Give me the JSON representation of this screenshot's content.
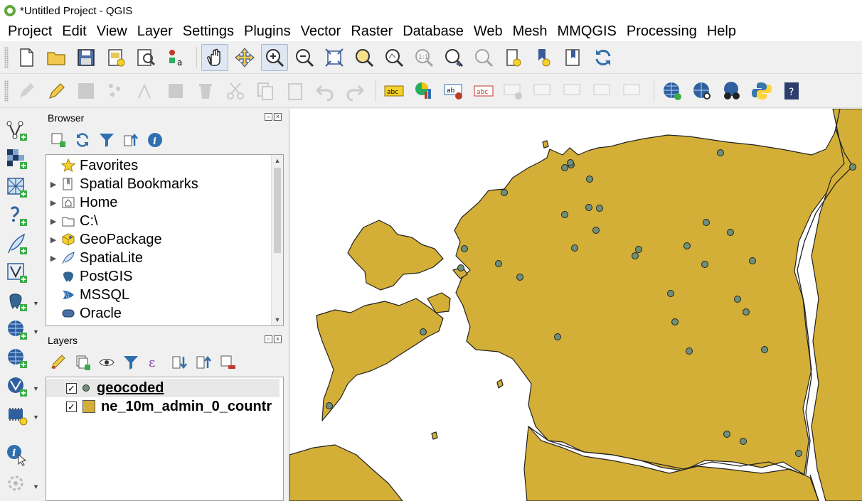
{
  "window": {
    "title": "*Untitled Project - QGIS"
  },
  "menu": [
    "Project",
    "Edit",
    "View",
    "Layer",
    "Settings",
    "Plugins",
    "Vector",
    "Raster",
    "Database",
    "Web",
    "Mesh",
    "MMQGIS",
    "Processing",
    "Help"
  ],
  "browser": {
    "title": "Browser",
    "items": [
      {
        "label": "Favorites",
        "icon": "star-icon",
        "expandable": false
      },
      {
        "label": "Spatial Bookmarks",
        "icon": "bookmark-icon",
        "expandable": true
      },
      {
        "label": "Home",
        "icon": "home-folder-icon",
        "expandable": true
      },
      {
        "label": "C:\\",
        "icon": "folder-icon",
        "expandable": true
      },
      {
        "label": "GeoPackage",
        "icon": "geopackage-icon",
        "expandable": true
      },
      {
        "label": "SpatiaLite",
        "icon": "spatialite-icon",
        "expandable": true
      },
      {
        "label": "PostGIS",
        "icon": "postgis-icon",
        "expandable": false
      },
      {
        "label": "MSSQL",
        "icon": "mssql-icon",
        "expandable": false
      },
      {
        "label": "Oracle",
        "icon": "oracle-icon",
        "expandable": false
      }
    ]
  },
  "layers": {
    "title": "Layers",
    "items": [
      {
        "label": "geocoded",
        "checked": true,
        "selected": true,
        "type": "point"
      },
      {
        "label": "ne_10m_admin_0_countr",
        "checked": true,
        "selected": false,
        "type": "polygon"
      }
    ]
  },
  "map": {
    "land_color": "#d4af37",
    "point_color": "#6e907a",
    "water_color": "#ffffff"
  }
}
